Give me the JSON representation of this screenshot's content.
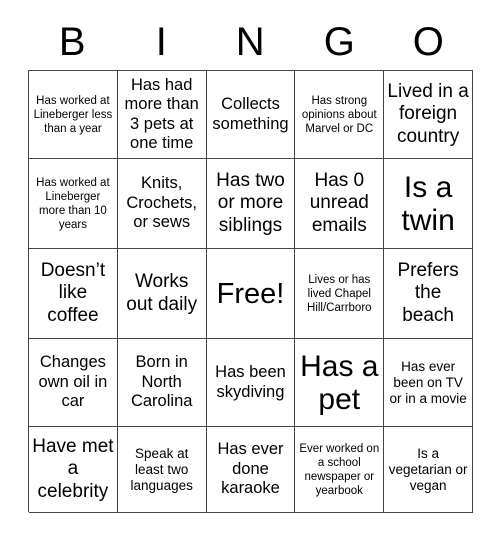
{
  "card": {
    "header_letters": [
      "B",
      "I",
      "N",
      "G",
      "O"
    ],
    "free_space_label": "Free!",
    "rows": [
      [
        {
          "text": "Has worked at Lineberger less than a year",
          "size": "xs"
        },
        {
          "text": "Has had more than 3 pets at one time",
          "size": "m"
        },
        {
          "text": "Collects something",
          "size": "m"
        },
        {
          "text": "Has strong opinions about Marvel or DC",
          "size": "xs"
        },
        {
          "text": "Lived in a foreign country",
          "size": "l"
        }
      ],
      [
        {
          "text": "Has worked at Lineberger more than 10 years",
          "size": "xs"
        },
        {
          "text": "Knits, Crochets, or sews",
          "size": "m"
        },
        {
          "text": "Has two or more siblings",
          "size": "l"
        },
        {
          "text": "Has 0 unread emails",
          "size": "l"
        },
        {
          "text": "Is a twin",
          "size": "xxl"
        }
      ],
      [
        {
          "text": "Doesn’t like coffee",
          "size": "l"
        },
        {
          "text": "Works out daily",
          "size": "l"
        },
        {
          "text": "Free!",
          "size": "free"
        },
        {
          "text": "Lives or has lived Chapel Hill/Carrboro",
          "size": "xs"
        },
        {
          "text": "Prefers the beach",
          "size": "l"
        }
      ],
      [
        {
          "text": "Changes own oil in car",
          "size": "m"
        },
        {
          "text": "Born in North Carolina",
          "size": "m"
        },
        {
          "text": "Has been skydiving",
          "size": "m"
        },
        {
          "text": "Has a pet",
          "size": "xxl"
        },
        {
          "text": "Has ever been on TV or in a movie",
          "size": "s"
        }
      ],
      [
        {
          "text": "Have met a celebrity",
          "size": "l"
        },
        {
          "text": "Speak at least two languages",
          "size": "s"
        },
        {
          "text": "Has ever done karaoke",
          "size": "m"
        },
        {
          "text": "Ever worked on a school newspaper or yearbook",
          "size": "xs"
        },
        {
          "text": "Is a vegetarian or vegan",
          "size": "s"
        }
      ]
    ]
  },
  "colors": {
    "background": "#ffffff",
    "text": "#000000",
    "grid_line": "#444444"
  }
}
